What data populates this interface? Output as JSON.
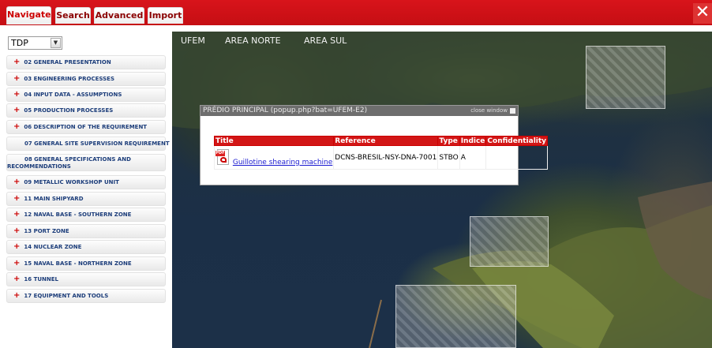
{
  "tabs": [
    {
      "label": "Navigate",
      "active": true
    },
    {
      "label": "Search",
      "active": false
    },
    {
      "label": "Advanced",
      "active": false
    },
    {
      "label": "Import",
      "active": false
    }
  ],
  "close_button": "✕",
  "selector": {
    "value": "TDP"
  },
  "nav_items": [
    {
      "label": "02 GENERAL PRESENTATION",
      "expandable": true
    },
    {
      "label": "03 ENGINEERING PROCESSES",
      "expandable": true
    },
    {
      "label": "04 INPUT DATA - ASSUMPTIONS",
      "expandable": true
    },
    {
      "label": "05 PRODUCTION PROCESSES",
      "expandable": true
    },
    {
      "label": "06 DESCRIPTION OF THE REQUIREMENT",
      "expandable": true
    },
    {
      "label": "07 GENERAL SITE SUPERVISION REQUIREMENT",
      "expandable": false
    },
    {
      "label_line1": "08 GENERAL SPECIFICATIONS AND",
      "label_line2": "RECOMMENDATIONS",
      "expandable": false
    },
    {
      "label": "09 METALLIC WORKSHOP UNIT",
      "expandable": true
    },
    {
      "label": "11 MAIN SHIPYARD",
      "expandable": true
    },
    {
      "label": "12 NAVAL BASE - SOUTHERN ZONE",
      "expandable": true
    },
    {
      "label": "13 PORT ZONE",
      "expandable": true
    },
    {
      "label": "14 NUCLEAR ZONE",
      "expandable": true
    },
    {
      "label": "15 NAVAL BASE - NORTHERN ZONE",
      "expandable": true
    },
    {
      "label": "16 TUNNEL",
      "expandable": true
    },
    {
      "label": "17 EQUIPMENT AND TOOLS",
      "expandable": true
    }
  ],
  "map_menu": [
    "UFEM",
    "AREA NORTE",
    "AREA SUL"
  ],
  "popup": {
    "title": "PRÉDIO PRINCIPAL (popup.php?bat=UFEM-E2)",
    "close_label": "close window",
    "columns": [
      "Title",
      "Reference",
      "Type",
      "Indice",
      "Confidentiality"
    ],
    "rows": [
      {
        "title": "Guillotine shearing machine",
        "reference": "DCNS-BRESIL-NSY-DNA-7001",
        "type": "STBO",
        "indice": "A",
        "confidentiality": ""
      }
    ],
    "icon": "pdf-icon"
  },
  "colors": {
    "accent": "#d21616",
    "link": "#1a1ad0",
    "nav_text": "#1c3d7a"
  }
}
